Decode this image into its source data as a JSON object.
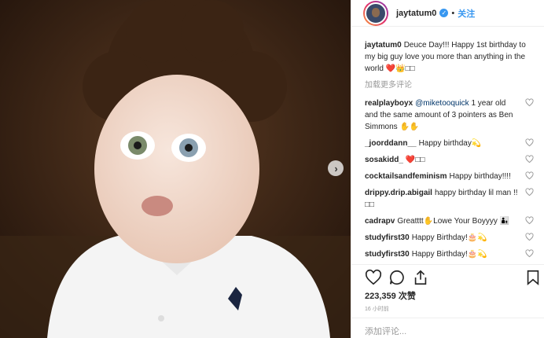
{
  "header": {
    "username": "jaytatum0",
    "dot": "•",
    "follow_label": "关注"
  },
  "caption": {
    "username": "jaytatum0",
    "text": "Deuce Day!!! Happy 1st birthday to my big guy love you more than anything in the world ❤️👑□□"
  },
  "load_more": "加载更多评论",
  "comments": [
    {
      "user": "realplayboyx",
      "mention": "@miketooquick",
      "text": " 1 year old and the same amount of 3 pointers as Ben Simmons ✋✋"
    },
    {
      "user": "_joorddann__",
      "mention": "",
      "text": "Happy birthday💫"
    },
    {
      "user": "sosakidd_",
      "mention": "",
      "text": "❤️□□"
    },
    {
      "user": "cocktailsandfeminism",
      "mention": "",
      "text": "Happy birthday!!!!"
    },
    {
      "user": "drippy.drip.abigail",
      "mention": "",
      "text": "happy birthday lil man !!□□"
    },
    {
      "user": "cadrapv",
      "mention": "",
      "text": "Greatttt✋Lowe Your Boyyyy 👨‍👦"
    },
    {
      "user": "studyfirst30",
      "mention": "",
      "text": "Happy Birthday!🎂💫"
    },
    {
      "user": "studyfirst30",
      "mention": "",
      "text": "Happy Birthday!🎂💫"
    }
  ],
  "likes_text": "223,359 次赞",
  "time_text": "16 小时前",
  "add_comment": {
    "placeholder": "添加评论..."
  },
  "colors": {
    "link": "#3897f0",
    "text": "#262626",
    "muted": "#999999"
  },
  "icons": [
    "heart-icon",
    "comment-icon",
    "share-icon",
    "bookmark-icon",
    "next-arrow-icon",
    "verified-icon"
  ]
}
